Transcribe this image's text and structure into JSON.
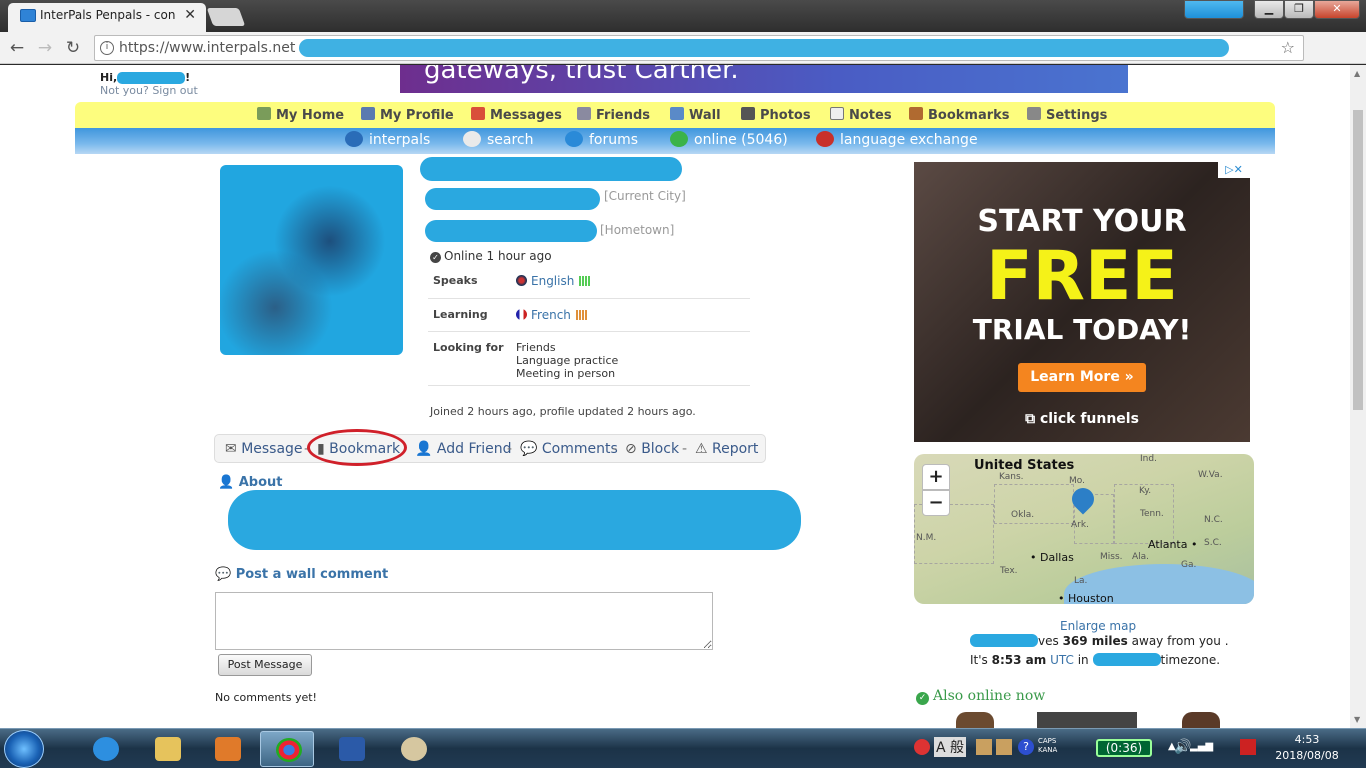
{
  "browser": {
    "tab_title": "InterPals Penpals - con",
    "url": "https://www.interpals.net"
  },
  "header": {
    "greeting": "Hi,",
    "greeting_end": "!",
    "signout": "Not you? Sign out",
    "banner_text": "gateways, trust Carther."
  },
  "top_nav": [
    {
      "label": "My Home",
      "icon": "home-icon",
      "color": "#7a9c5a"
    },
    {
      "label": "My Profile",
      "icon": "profile-icon",
      "color": "#5a7ab0"
    },
    {
      "label": "Messages",
      "icon": "envelope-icon",
      "color": "#d94f3a"
    },
    {
      "label": "Friends",
      "icon": "friends-icon",
      "color": "#8a8aa0"
    },
    {
      "label": "Wall",
      "icon": "wall-icon",
      "color": "#5a8ac8"
    },
    {
      "label": "Photos",
      "icon": "photos-icon",
      "color": "#555555"
    },
    {
      "label": "Notes",
      "icon": "notes-icon",
      "color": "#eeeeee"
    },
    {
      "label": "Bookmarks",
      "icon": "bookmarks-icon",
      "color": "#b06a30"
    },
    {
      "label": "Settings",
      "icon": "settings-icon",
      "color": "#888888"
    }
  ],
  "sub_nav": [
    {
      "label": "interpals",
      "icon": "globe-icon",
      "color": "#2a6cb8"
    },
    {
      "label": "search",
      "icon": "search-icon",
      "color": "#eaeaea"
    },
    {
      "label": "forums",
      "icon": "forums-icon",
      "color": "#2a8ad8"
    },
    {
      "label": "online (5046)",
      "icon": "online-icon",
      "color": "#3bb34a"
    },
    {
      "label": "language exchange",
      "icon": "flags-icon",
      "color": "#c8302a"
    }
  ],
  "profile": {
    "current_city": "[Current City]",
    "hometown": "[Hometown]",
    "online_status": "Online 1 hour ago",
    "speaks_label": "Speaks",
    "speaks_value": "English",
    "learning_label": "Learning",
    "learning_value": "French",
    "looking_label": "Looking for",
    "looking_values": [
      "Friends",
      "Language practice",
      "Meeting in person"
    ],
    "joined": "Joined 2 hours ago, profile updated 2 hours ago."
  },
  "actions": [
    "Message",
    "Bookmark",
    "Add Friend",
    "Comments",
    "Block",
    "Report"
  ],
  "about_heading": "About",
  "wall": {
    "heading": "Post a wall comment",
    "post_button": "Post Message",
    "no_comments": "No comments yet!"
  },
  "ad": {
    "line1": "START YOUR",
    "line2": "FREE",
    "line3": "TRIAL TODAY!",
    "cta": "Learn More »",
    "brand": "click funnels"
  },
  "map": {
    "title": "United States",
    "zoom_in": "+",
    "zoom_out": "−",
    "labels": [
      "Kans.",
      "Mo.",
      "Ky.",
      "Ind.",
      "W.Va.",
      "Okla.",
      "Tenn.",
      "N.C.",
      "N.M.",
      "Ark.",
      "S.C.",
      "Miss.",
      "Ala.",
      "Ga.",
      "Tex.",
      "La."
    ],
    "cities": [
      "Dallas",
      "Atlanta",
      "Houston"
    ]
  },
  "location": {
    "enlarge": "Enlarge map",
    "lives_suffix": "ves",
    "distance": "369 miles",
    "distance_suffix": "away from you .",
    "time_prefix": "It's",
    "time": "8:53 am",
    "utc": "UTC",
    "in": "in",
    "timezone_suffix": "timezone."
  },
  "also_online": "Also online now",
  "taskbar": {
    "time": "4:53",
    "date": "2018/08/08",
    "ime": "A 般",
    "timer": "0:36"
  }
}
